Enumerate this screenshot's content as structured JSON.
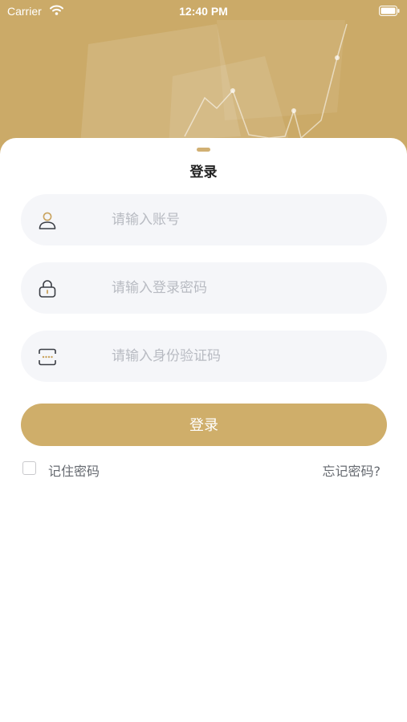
{
  "status_bar": {
    "carrier": "Carrier",
    "time": "12:40 PM"
  },
  "login": {
    "title": "登录",
    "account_placeholder": "请输入账号",
    "password_placeholder": "请输入登录密码",
    "idcode_placeholder": "请输入身份验证码",
    "submit_label": "登录",
    "remember_label": "记住密码",
    "forgot_label": "忘记密码?"
  },
  "colors": {
    "accent": "#cfae6a",
    "field_bg": "#f5f6f9",
    "placeholder": "#b8bbc2"
  },
  "icons": {
    "account": "user-icon",
    "password": "lock-icon",
    "idcode": "verify-code-icon"
  }
}
